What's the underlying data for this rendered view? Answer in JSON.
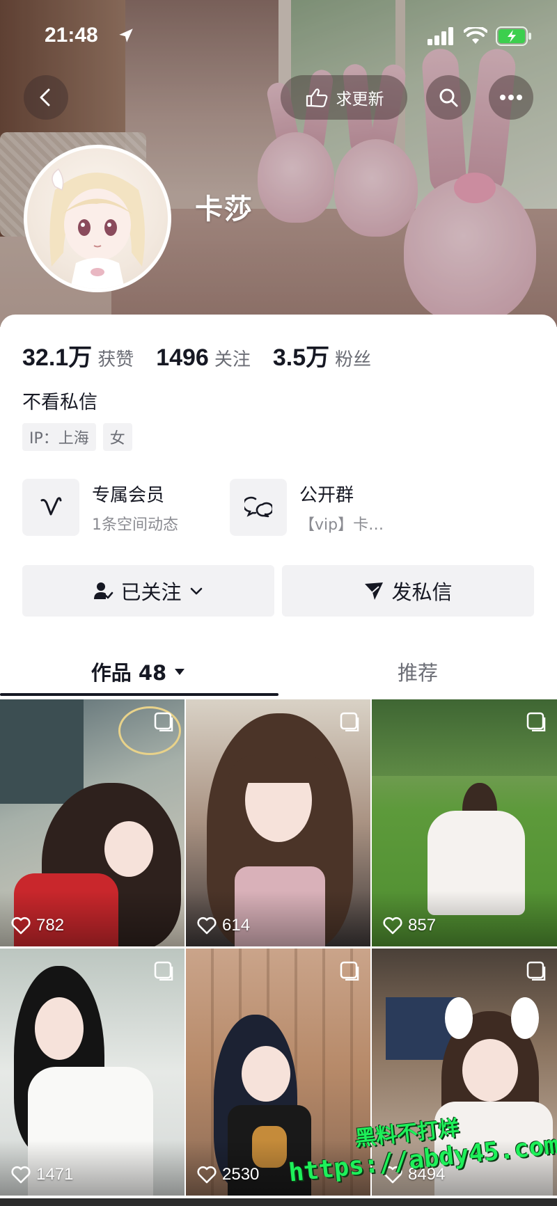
{
  "status_bar": {
    "time": "21:48",
    "icons": [
      "location-arrow-icon",
      "signal-icon",
      "wifi-icon",
      "battery-charging-icon"
    ]
  },
  "header": {
    "update_button_label": "求更新",
    "icons": [
      "back-icon",
      "hand-point-icon",
      "search-icon",
      "more-icon"
    ]
  },
  "profile": {
    "username": "卡莎",
    "stats": [
      {
        "number": "32.1万",
        "label": "获赞"
      },
      {
        "number": "1496",
        "label": "关注"
      },
      {
        "number": "3.5万",
        "label": "粉丝"
      }
    ],
    "bio": "不看私信",
    "tags": [
      "IP：上海",
      "女"
    ]
  },
  "features": [
    {
      "title": "专属会员",
      "subtitle": "1条空间动态",
      "icon": "vip-v-icon"
    },
    {
      "title": "公开群",
      "subtitle": "【vip】卡…",
      "icon": "group-chat-icon"
    }
  ],
  "actions": {
    "follow_label": "已关注",
    "dm_label": "发私信"
  },
  "tabs": {
    "works_label": "作品 48",
    "recommend_label": "推荐"
  },
  "grid": [
    {
      "likes": "782"
    },
    {
      "likes": "614"
    },
    {
      "likes": "857"
    },
    {
      "likes": "1471"
    },
    {
      "likes": "2530"
    },
    {
      "likes": "8494"
    }
  ],
  "watermark": {
    "line1": "黑料不打烊",
    "line2": "https://abdy45.com"
  },
  "colors": {
    "text_primary": "#161823",
    "text_secondary": "#6b6d75",
    "button_bg": "#f2f2f4",
    "watermark_green": "#1ef05a"
  }
}
